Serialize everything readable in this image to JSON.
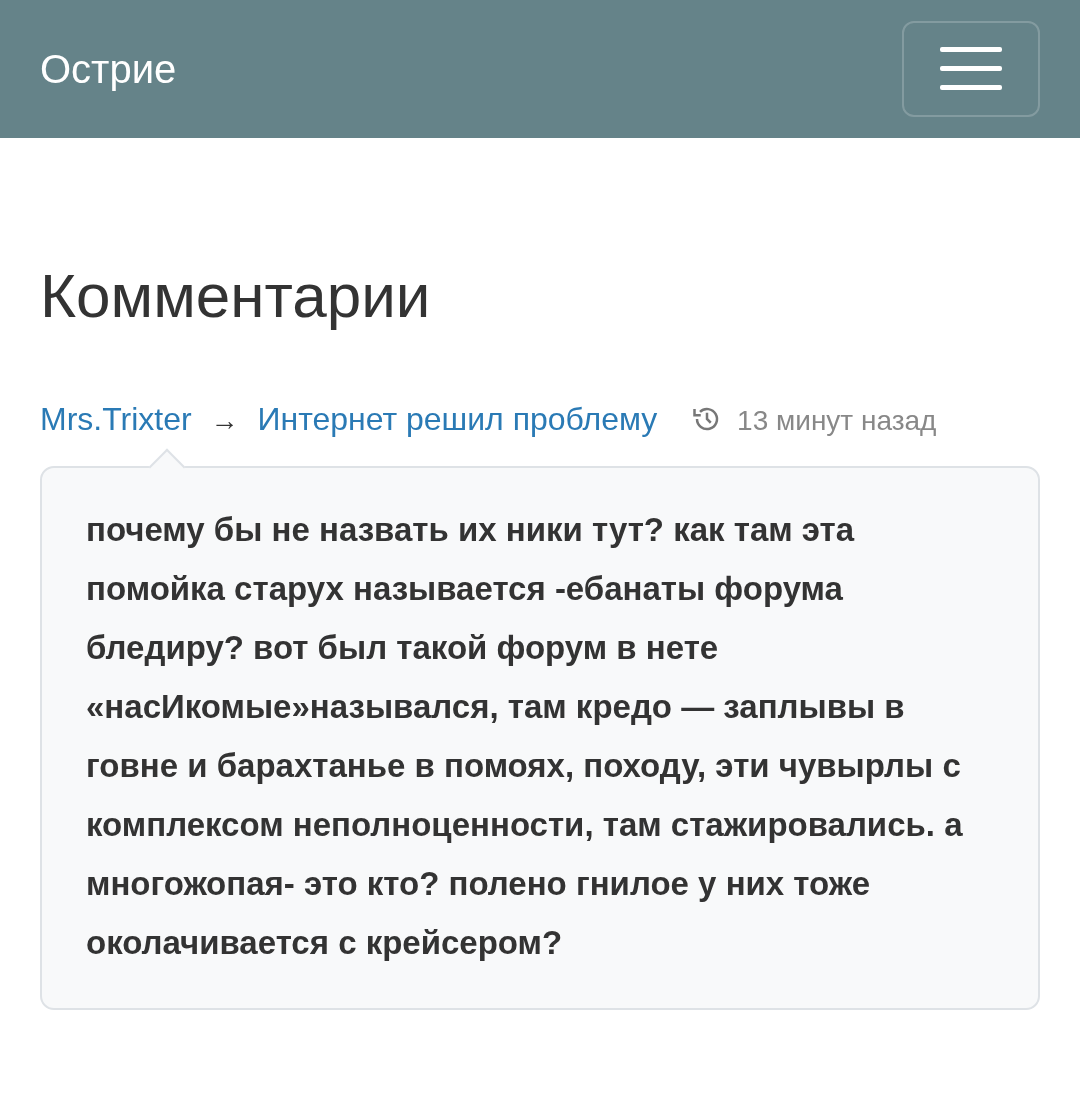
{
  "header": {
    "title": "Острие"
  },
  "heading": "Комментарии",
  "comment": {
    "author": "Mrs.Trixter",
    "arrow": "→",
    "post_title": "Интернет решил проблему",
    "time": "13 минут назад",
    "text": "почему бы не назвать их ники тут? как там эта помойка старух называется -ебанаты форума бледиру? вот был такой форум в нете «насИкомые»назывался, там кредо — заплывы в говне и барахтанье в помоях, походу, эти чувырлы с комплексом неполноценности, там стажировались. а многожопая- это кто? полено гнилое у них тоже околачивается с крейсером?"
  }
}
